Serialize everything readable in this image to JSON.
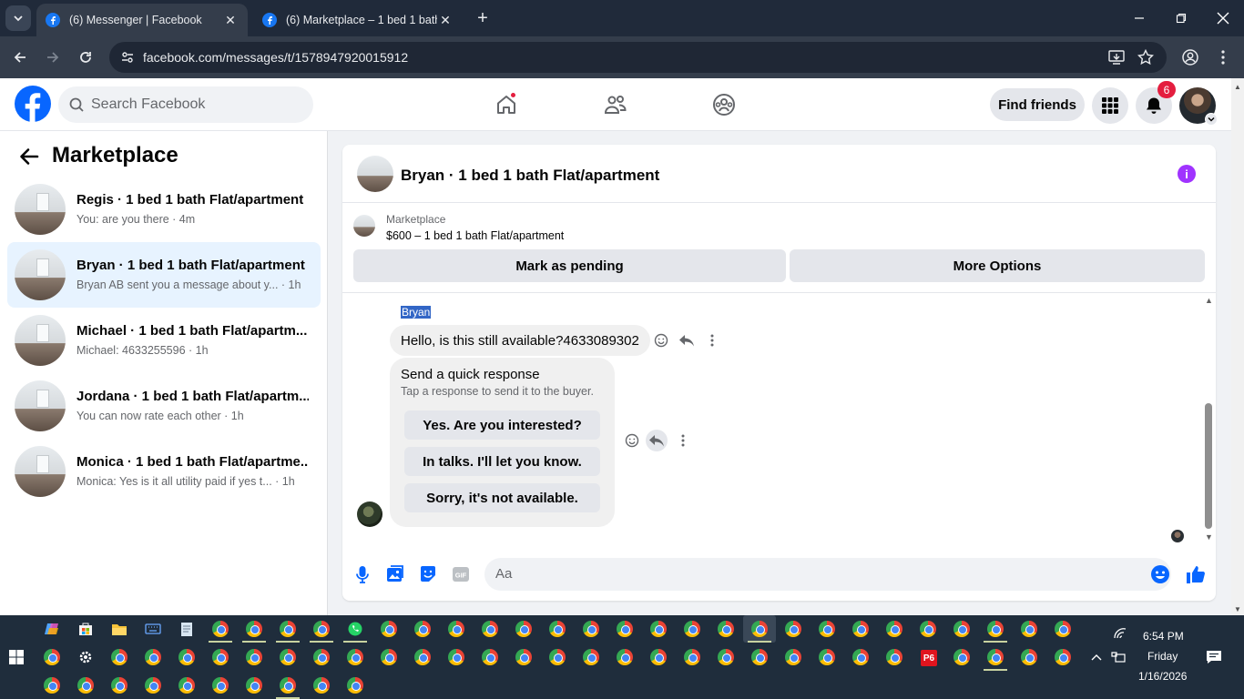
{
  "browser": {
    "tabs": [
      {
        "title": "(6) Messenger | Facebook",
        "active": true
      },
      {
        "title": "(6) Marketplace – 1 bed 1 bath Fl",
        "active": false
      }
    ],
    "url": "facebook.com/messages/t/1578947920015912"
  },
  "fb_header": {
    "search_placeholder": "Search Facebook",
    "find_friends_label": "Find friends",
    "notification_count": "6",
    "brand_color": "#1877f2"
  },
  "sidebar": {
    "title": "Marketplace",
    "conversations": [
      {
        "name": "Regis · 1 bed 1 bath Flat/apartment",
        "preview": "You: are you there · 4m",
        "active": false
      },
      {
        "name": "Bryan · 1 bed 1 bath Flat/apartment",
        "preview": "Bryan AB sent you a message about y... · 1h",
        "active": true
      },
      {
        "name": "Michael · 1 bed 1 bath Flat/apartm...",
        "preview": "Michael: 4633255596 · 1h",
        "active": false
      },
      {
        "name": "Jordana · 1 bed 1 bath Flat/apartm...",
        "preview": "You can now rate each other · 1h",
        "active": false
      },
      {
        "name": "Monica · 1 bed 1 bath Flat/apartme...",
        "preview": "Monica: Yes is it all utility paid if yes t...  · 1h",
        "active": false
      }
    ]
  },
  "chat": {
    "title": "Bryan · 1 bed 1 bath Flat/apartment",
    "listing_category": "Marketplace",
    "listing_price_title": "$600 – 1 bed 1 bath Flat/apartment",
    "mark_pending_label": "Mark as pending",
    "more_options_label": "More Options",
    "sender_name": "Bryan",
    "message_text": "Hello, is this still available?4633089302",
    "quick_response": {
      "title": "Send a quick response",
      "subtitle": "Tap a response to send it to the buyer.",
      "options": [
        "Yes. Are you interested?",
        "In talks. I'll let you know.",
        "Sorry, it's not available."
      ]
    },
    "composer_placeholder": "Aa",
    "accent_color": "#0866ff"
  },
  "taskbar": {
    "time": "6:54 PM",
    "day": "Friday",
    "date": "1/16/2026",
    "p6_label": "P6"
  }
}
